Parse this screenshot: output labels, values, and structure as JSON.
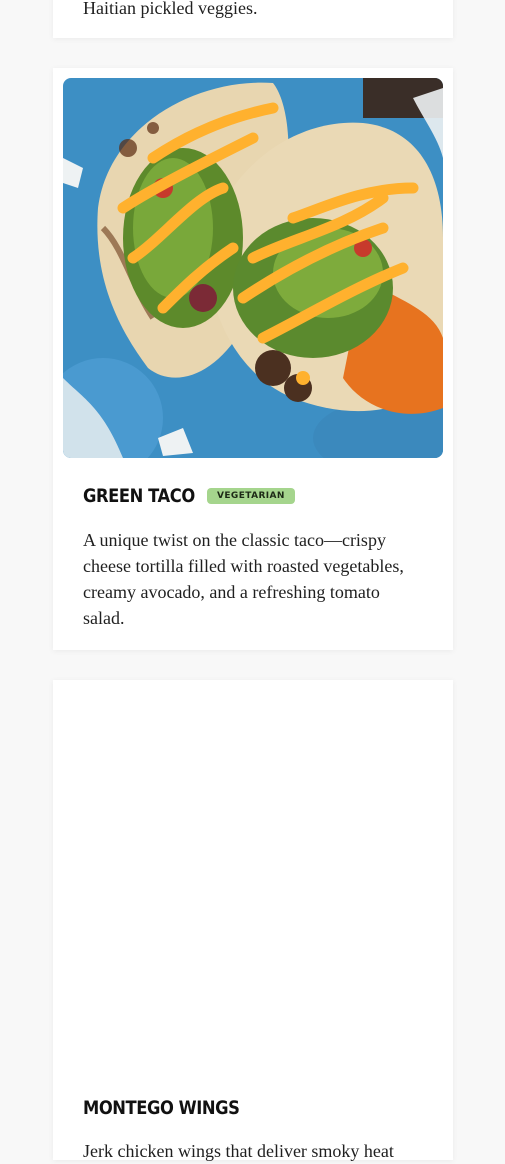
{
  "cards": [
    {
      "description": "Haitian pickled veggies."
    },
    {
      "name": "Green Taco",
      "badge": "Vegetarian",
      "description": "A unique twist on the classic taco—crispy cheese tortilla filled with roasted vegetables, creamy avocado, and a refreshing tomato salad.",
      "image_alt": "Two green tacos topped with salsa and orange sauce on a blue plate"
    },
    {
      "name": "Montego Wings",
      "description": "Jerk chicken wings that deliver smoky heat"
    }
  ]
}
